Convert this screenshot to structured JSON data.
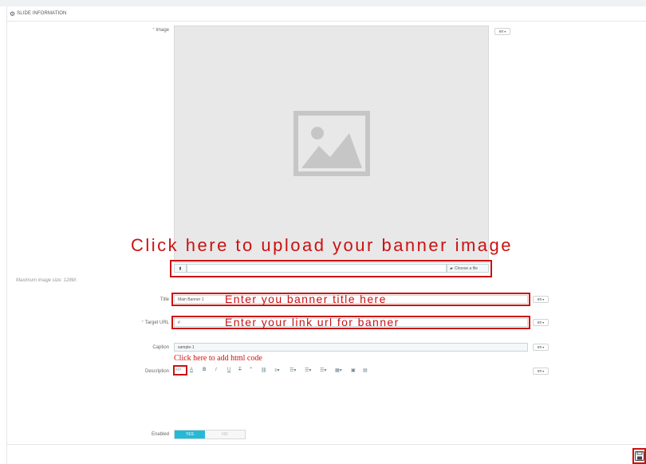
{
  "panel": {
    "title": "SLIDE INFORMATION"
  },
  "image": {
    "label": "Image",
    "required_mark": "*",
    "lang": "en",
    "upload_annotation": "Click here to upload your banner image",
    "choose_label": "Choose a file",
    "hint": "Maximum image size: 128M."
  },
  "title_field": {
    "label": "Title",
    "value": "Main Banner 1",
    "annotation": "Enter you banner title here",
    "lang": "en"
  },
  "target_url": {
    "label": "Target URL",
    "required_mark": "*",
    "value": "#",
    "annotation": "Enter your link url for banner",
    "lang": "en"
  },
  "caption": {
    "label": "Caption",
    "value": "sample-1",
    "lang": "en"
  },
  "description": {
    "label": "Description",
    "annotation": "Click here to add html code",
    "lang": "en"
  },
  "enabled": {
    "label": "Enabled",
    "yes": "YES",
    "no": "NO"
  },
  "colors": {
    "accent": "#25b9d7",
    "annotation": "#cc1111"
  }
}
